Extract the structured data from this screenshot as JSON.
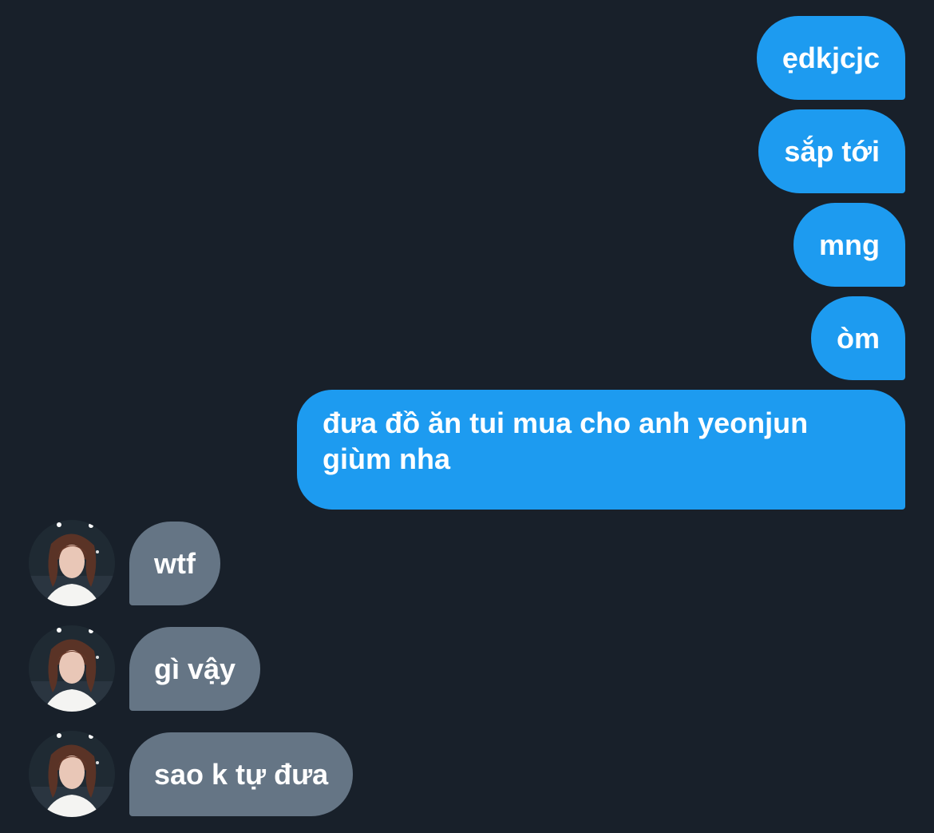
{
  "conversation": {
    "sent_messages": [
      {
        "text": "ẹdkjcjc"
      },
      {
        "text": "sắp tới"
      },
      {
        "text": "mng"
      },
      {
        "text": "òm"
      },
      {
        "text": "đưa đồ ăn tui mua cho anh yeonjun giùm nha"
      }
    ],
    "received_messages": [
      {
        "text": "wtf"
      },
      {
        "text": "gì vậy"
      },
      {
        "text": "sao k tự đưa"
      }
    ]
  },
  "colors": {
    "background": "#18202a",
    "sent_bubble": "#1d9bf0",
    "received_bubble": "#657585",
    "text": "#ffffff"
  },
  "icons": {
    "avatar": "user-avatar-photo"
  }
}
